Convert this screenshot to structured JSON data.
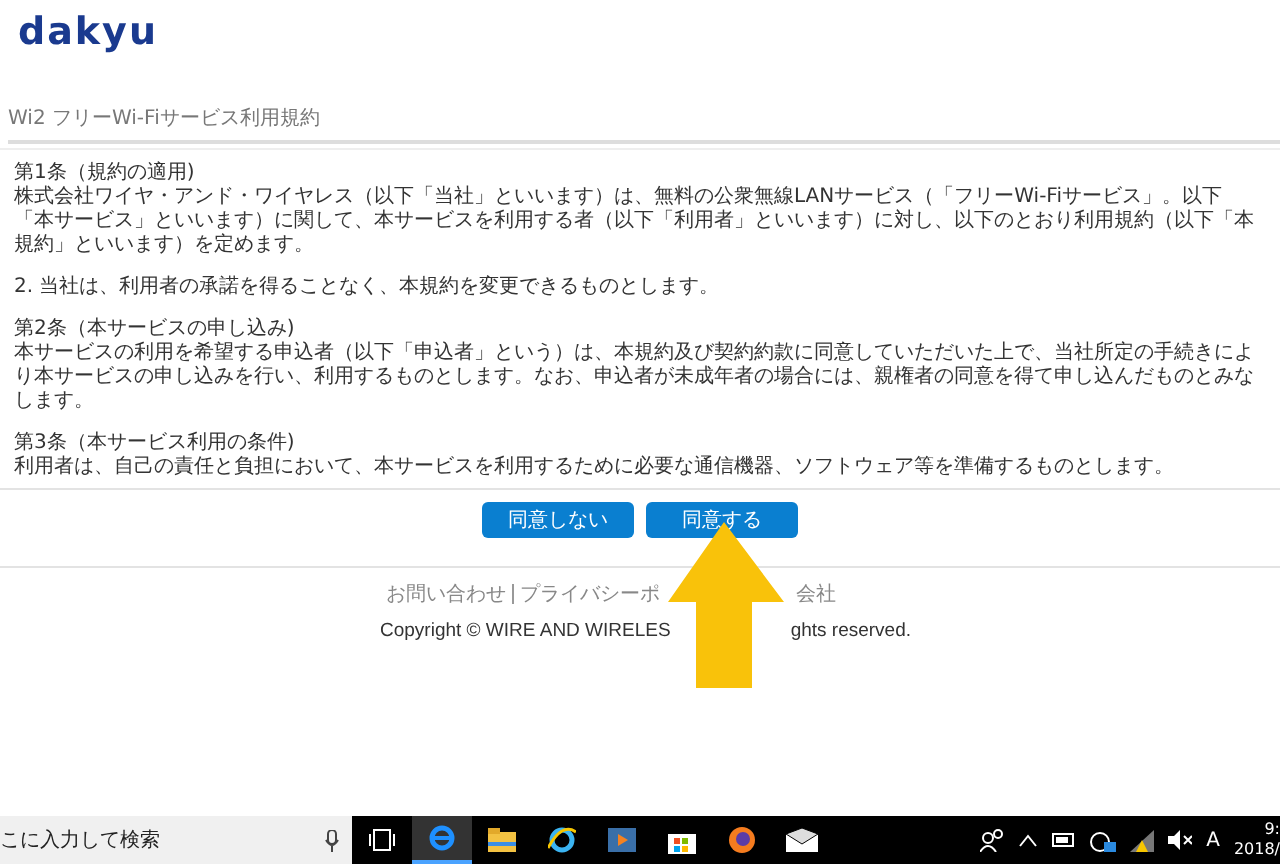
{
  "logo": "dakyu",
  "title": "Wi2 フリーWi-Fiサービス利用規約",
  "terms": [
    {
      "kind": "heading",
      "text": "第1条（規約の適用)"
    },
    {
      "kind": "para",
      "text": "株式会社ワイヤ・アンド・ワイヤレス（以下「当社」といいます）は、無料の公衆無線LANサービス（「フリーWi-Fiサービス」。以下「本サービス」といいます）に関して、本サービスを利用する者（以下「利用者」といいます）に対し、以下のとおり利用規約（以下「本規約」といいます）を定めます。"
    },
    {
      "kind": "gap"
    },
    {
      "kind": "para",
      "text": "2. 当社は、利用者の承諾を得ることなく、本規約を変更できるものとします。"
    },
    {
      "kind": "gap"
    },
    {
      "kind": "heading",
      "text": "第2条（本サービスの申し込み)"
    },
    {
      "kind": "para",
      "text": "本サービスの利用を希望する申込者（以下「申込者」という）は、本規約及び契約約款に同意していただいた上で、当社所定の手続きにより本サービスの申し込みを行い、利用するものとします。なお、申込者が未成年者の場合には、親権者の同意を得て申し込んだものとみなします。"
    },
    {
      "kind": "gap"
    },
    {
      "kind": "heading",
      "text": "第3条（本サービス利用の条件)"
    },
    {
      "kind": "para",
      "text": "利用者は、自己の責任と負担において、本サービスを利用するために必要な通信機器、ソフトウェア等を準備するものとします。"
    }
  ],
  "buttons": [
    "同意しない",
    "同意する"
  ],
  "footer_links": [
    "お問い合わせ",
    "プライバシーポ"
  ],
  "footer_link_tail": "会社",
  "copyright": [
    "Copyright © WIRE AND WIRELES",
    "ghts reserved."
  ],
  "taskbar": {
    "search_placeholder": "こに入力して検索",
    "ime": "A",
    "time": "9:",
    "date": "2018/"
  }
}
